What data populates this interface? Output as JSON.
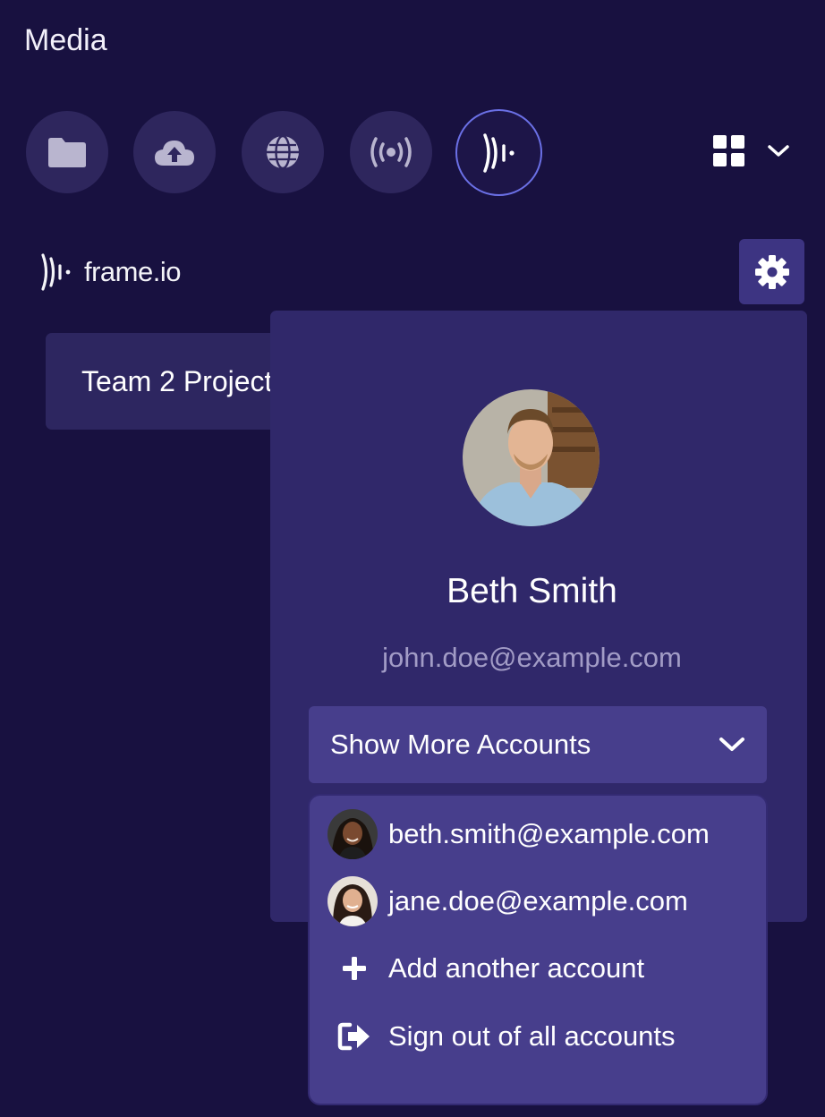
{
  "header": {
    "title": "Media"
  },
  "sources": [
    {
      "name": "folder-icon",
      "active": false
    },
    {
      "name": "cloud-upload-icon",
      "active": false
    },
    {
      "name": "globe-icon",
      "active": false
    },
    {
      "name": "broadcast-icon",
      "active": false
    },
    {
      "name": "frameio-icon",
      "active": true
    }
  ],
  "view_toggle": {
    "icon": "grid-icon",
    "dropdown": "chevron-down-icon"
  },
  "brand": {
    "name": "frame.io"
  },
  "project": {
    "label": "Team 2 Project"
  },
  "profile": {
    "name": "Beth Smith",
    "email": "john.doe@example.com",
    "show_more_label": "Show More Accounts"
  },
  "accounts_menu": {
    "accounts": [
      {
        "email": "beth.smith@example.com"
      },
      {
        "email": "jane.doe@example.com"
      }
    ],
    "add_account": "Add another account",
    "sign_out": "Sign out of all accounts"
  },
  "colors": {
    "background": "#181140",
    "button": "#2e265d",
    "active_ring": "#6b70e6",
    "panel": "#30286a",
    "menu": "#473e8c"
  }
}
